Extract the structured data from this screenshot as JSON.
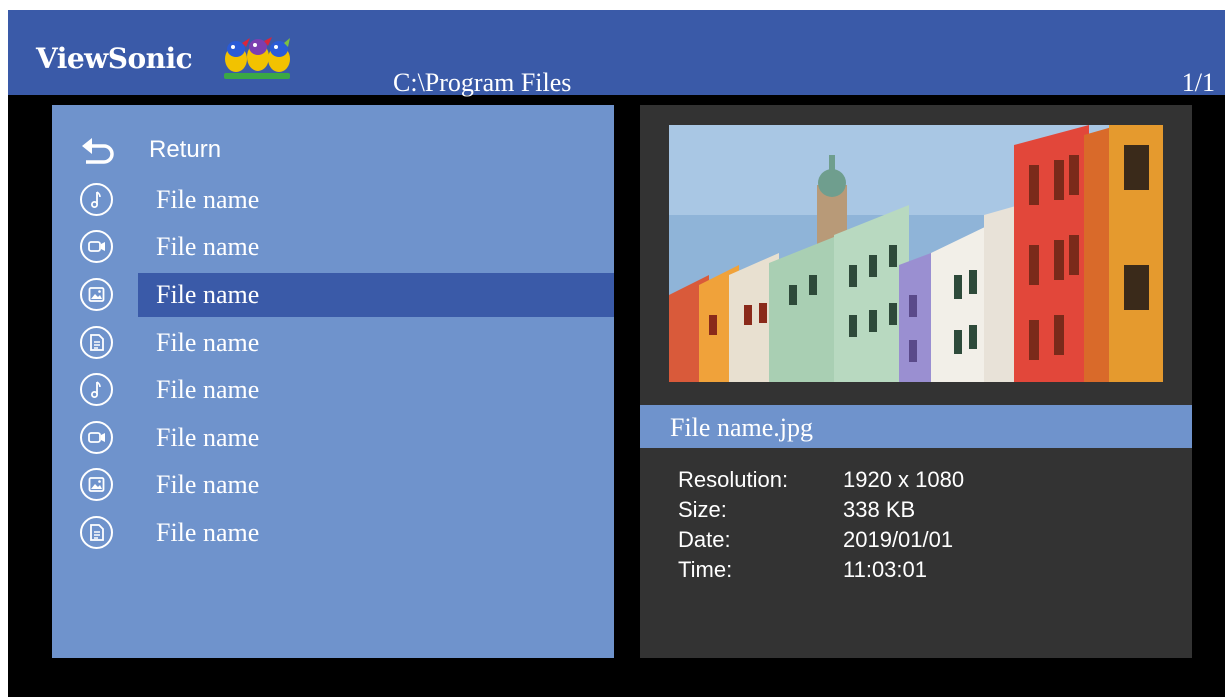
{
  "header": {
    "brand": "ViewSonic",
    "path": "C:\\Program Files",
    "page": "1/1"
  },
  "list": {
    "return_label": "Return",
    "items": [
      {
        "icon": "music-note-icon",
        "label": "File name"
      },
      {
        "icon": "video-icon",
        "label": "File name"
      },
      {
        "icon": "image-icon",
        "label": "File name",
        "selected": true
      },
      {
        "icon": "document-icon",
        "label": "File name"
      },
      {
        "icon": "music-note-icon",
        "label": "File name"
      },
      {
        "icon": "video-icon",
        "label": "File name"
      },
      {
        "icon": "image-icon",
        "label": "File name"
      },
      {
        "icon": "document-icon",
        "label": "File name"
      }
    ]
  },
  "detail": {
    "filename": "File name.jpg",
    "info": [
      {
        "label": "Resolution:",
        "value": "1920 x 1080"
      },
      {
        "label": "Size:",
        "value": "338 KB"
      },
      {
        "label": "Date:",
        "value": "2019/01/01"
      },
      {
        "label": "Time:",
        "value": "11:03:01"
      }
    ]
  },
  "colors": {
    "header_blue": "#3a5aa8",
    "panel_light_blue": "#6f93cc",
    "panel_dark": "#333333",
    "background": "#000000"
  }
}
